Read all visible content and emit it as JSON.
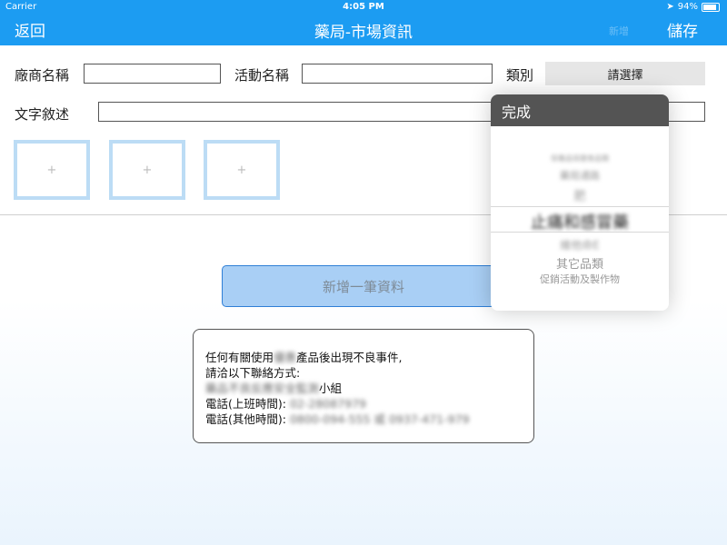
{
  "status_bar": {
    "carrier": "Carrier",
    "time": "4:05 PM",
    "battery": "94%"
  },
  "nav": {
    "back_label": "返回",
    "title": "藥局-市場資訊",
    "faded_label": "新增",
    "save_label": "儲存"
  },
  "form": {
    "vendor_label": "廠商名稱",
    "vendor_value": "",
    "activity_label": "活動名稱",
    "activity_value": "",
    "category_label": "類別",
    "category_button": "請選擇",
    "description_label": "文字敘述",
    "description_value": ""
  },
  "photos": [
    "+",
    "+",
    "+"
  ],
  "add_button_label": "新增一筆資料",
  "notice": {
    "line1_prefix": "任何有關使用",
    "line1_blur": "優惠",
    "line1_suffix": "產品後出現不良事件,",
    "line2": "請洽以下聯絡方式:",
    "line3_blur": "藥品不良反應安全監測",
    "line3_suffix": "小組",
    "line4_prefix": "電話(上班時間):",
    "line4_blur": "02-28087979",
    "line5_prefix": "電話(其他時間):",
    "line5_blur": "0800-094-555 或 0937-471-979"
  },
  "picker": {
    "done_label": "完成",
    "options": [
      "保養品保健食品類",
      "藥局通路",
      "肥",
      "止痛和感冒藥",
      "維他命E",
      "其它品類",
      "促銷活動及製作物"
    ],
    "selected_index": 3
  }
}
